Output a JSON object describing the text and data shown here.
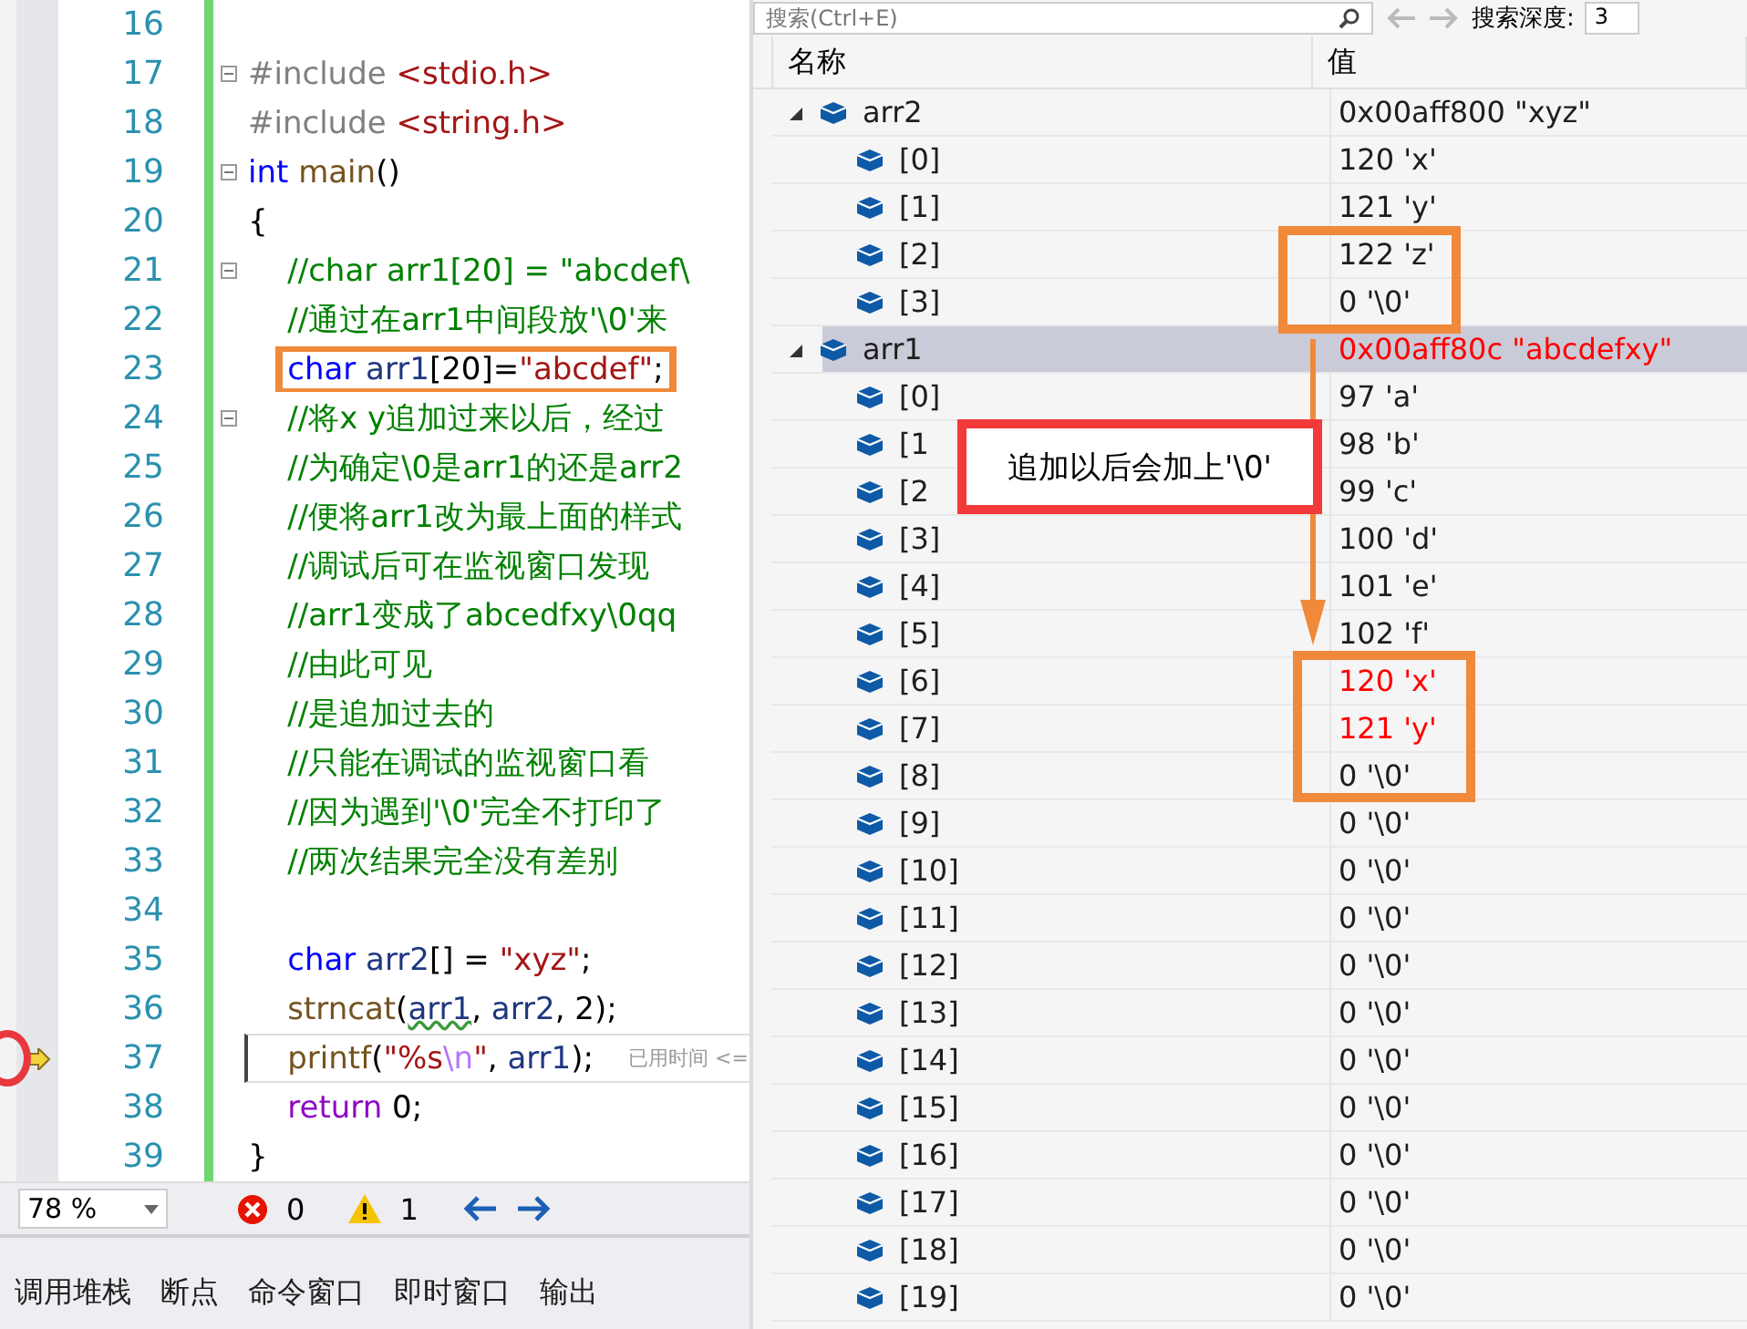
{
  "editor": {
    "lines": [
      {
        "number": "16"
      },
      {
        "number": "17",
        "fold": true,
        "tokens": [
          {
            "kind": "pre",
            "text": "#include "
          },
          {
            "kind": "path",
            "text": "<stdio.h>"
          }
        ]
      },
      {
        "number": "18",
        "tokens": [
          {
            "kind": "pre",
            "text": "#include "
          },
          {
            "kind": "path",
            "text": "<string.h>"
          }
        ]
      },
      {
        "number": "19",
        "fold": true,
        "tokens": [
          {
            "kind": "kw",
            "text": "int"
          },
          {
            "kind": "fn",
            "text": " main"
          },
          {
            "kind": "plain",
            "text": "()"
          }
        ]
      },
      {
        "number": "20",
        "tokens": [
          {
            "kind": "plain",
            "text": "{"
          }
        ]
      },
      {
        "number": "21",
        "fold": true,
        "tokens": [
          {
            "kind": "cm",
            "text": "    //char arr1[20] = \"abcdef\\"
          }
        ]
      },
      {
        "number": "22",
        "tokens": [
          {
            "kind": "cm",
            "text": "    //通过在arr1中间段放'\\0'来"
          }
        ]
      },
      {
        "number": "23",
        "highlighted": true,
        "tokens": [
          {
            "kind": "kw",
            "text": "    char"
          },
          {
            "kind": "id",
            "text": " arr1"
          },
          {
            "kind": "plain",
            "text": "[20]="
          },
          {
            "kind": "str",
            "text": "\"abcdef\""
          },
          {
            "kind": "plain",
            "text": ";"
          }
        ]
      },
      {
        "number": "24",
        "fold": true,
        "tokens": [
          {
            "kind": "cm",
            "text": "    //将x y追加过来以后，经过"
          }
        ]
      },
      {
        "number": "25",
        "tokens": [
          {
            "kind": "cm",
            "text": "    //为确定\\0是arr1的还是arr2"
          }
        ]
      },
      {
        "number": "26",
        "tokens": [
          {
            "kind": "cm",
            "text": "    //便将arr1改为最上面的样式"
          }
        ]
      },
      {
        "number": "27",
        "tokens": [
          {
            "kind": "cm",
            "text": "    //调试后可在监视窗口发现"
          }
        ]
      },
      {
        "number": "28",
        "tokens": [
          {
            "kind": "cm",
            "text": "    //arr1变成了abcedfxy\\0qq"
          }
        ]
      },
      {
        "number": "29",
        "tokens": [
          {
            "kind": "cm",
            "text": "    //由此可见"
          }
        ]
      },
      {
        "number": "30",
        "tokens": [
          {
            "kind": "cm",
            "text": "    //是追加过去的"
          }
        ]
      },
      {
        "number": "31",
        "tokens": [
          {
            "kind": "cm",
            "text": "    //只能在调试的监视窗口看"
          }
        ]
      },
      {
        "number": "32",
        "tokens": [
          {
            "kind": "cm",
            "text": "    //因为遇到'\\0'完全不打印了"
          }
        ]
      },
      {
        "number": "33",
        "tokens": [
          {
            "kind": "cm",
            "text": "    //两次结果完全没有差别"
          }
        ]
      },
      {
        "number": "34"
      },
      {
        "number": "35",
        "tokens": [
          {
            "kind": "kw",
            "text": "    char"
          },
          {
            "kind": "id",
            "text": " arr2"
          },
          {
            "kind": "plain",
            "text": "[] = "
          },
          {
            "kind": "str",
            "text": "\"xyz\""
          },
          {
            "kind": "plain",
            "text": ";"
          }
        ]
      },
      {
        "number": "36",
        "tokens": [
          {
            "kind": "fn",
            "text": "    strncat"
          },
          {
            "kind": "plain",
            "text": "("
          },
          {
            "kind": "id",
            "text": "arr1",
            "warn": true
          },
          {
            "kind": "plain",
            "text": ", "
          },
          {
            "kind": "id",
            "text": "arr2"
          },
          {
            "kind": "plain",
            "text": ", 2);"
          }
        ]
      },
      {
        "number": "37",
        "current": true,
        "hint": "已用时间 <=",
        "tokens": [
          {
            "kind": "fn",
            "text": "    printf"
          },
          {
            "kind": "plain",
            "text": "("
          },
          {
            "kind": "str",
            "text": "\"%s"
          },
          {
            "kind": "esc",
            "text": "\\n"
          },
          {
            "kind": "str",
            "text": "\""
          },
          {
            "kind": "plain",
            "text": ", "
          },
          {
            "kind": "id",
            "text": "arr1"
          },
          {
            "kind": "plain",
            "text": ");"
          }
        ]
      },
      {
        "number": "38",
        "tokens": [
          {
            "kind": "ctl",
            "text": "    return"
          },
          {
            "kind": "plain",
            "text": " 0;"
          }
        ]
      },
      {
        "number": "39",
        "tokens": [
          {
            "kind": "plain",
            "text": "}"
          }
        ]
      }
    ]
  },
  "status_bar": {
    "zoom": "78 %",
    "errors": "0",
    "warnings": "1"
  },
  "bottom_tabs": [
    "调用堆栈",
    "断点",
    "命令窗口",
    "即时窗口",
    "输出"
  ],
  "watch": {
    "search": {
      "placeholder": "搜索(Ctrl+E)"
    },
    "depth_label": "搜索深度:",
    "depth": "3",
    "columns": [
      "名称",
      "值"
    ],
    "rows": [
      {
        "name": "arr2",
        "value": "0x00aff800 \"xyz\"",
        "expanded": true,
        "selected": false,
        "changed": false,
        "children": [
          {
            "name": "[0]",
            "value": "120 'x'",
            "selected": false,
            "changed": false
          },
          {
            "name": "[1]",
            "value": "121 'y'",
            "selected": false,
            "changed": false
          },
          {
            "name": "[2]",
            "value": "122 'z'",
            "selected": false,
            "changed": false
          },
          {
            "name": "[3]",
            "value": "0 '\\0'",
            "selected": false,
            "changed": false
          }
        ]
      },
      {
        "name": "arr1",
        "value": "0x00aff80c \"abcdefxy\"",
        "expanded": true,
        "selected": true,
        "changed": true,
        "children": [
          {
            "name": "[0]",
            "value": "97 'a'",
            "selected": false,
            "changed": false
          },
          {
            "name": "[1",
            "value": "98 'b'",
            "selected": false,
            "changed": false
          },
          {
            "name": "[2",
            "value": "99 'c'",
            "selected": false,
            "changed": false
          },
          {
            "name": "[3]",
            "value": "100 'd'",
            "selected": false,
            "changed": false
          },
          {
            "name": "[4]",
            "value": "101 'e'",
            "selected": false,
            "changed": false
          },
          {
            "name": "[5]",
            "value": "102 'f'",
            "selected": false,
            "changed": false
          },
          {
            "name": "[6]",
            "value": "120 'x'",
            "selected": false,
            "changed": true
          },
          {
            "name": "[7]",
            "value": "121 'y'",
            "selected": false,
            "changed": true
          },
          {
            "name": "[8]",
            "value": "0 '\\0'",
            "selected": false,
            "changed": false
          },
          {
            "name": "[9]",
            "value": "0 '\\0'",
            "selected": false,
            "changed": false
          },
          {
            "name": "[10]",
            "value": "0 '\\0'",
            "selected": false,
            "changed": false
          },
          {
            "name": "[11]",
            "value": "0 '\\0'",
            "selected": false,
            "changed": false
          },
          {
            "name": "[12]",
            "value": "0 '\\0'",
            "selected": false,
            "changed": false
          },
          {
            "name": "[13]",
            "value": "0 '\\0'",
            "selected": false,
            "changed": false
          },
          {
            "name": "[14]",
            "value": "0 '\\0'",
            "selected": false,
            "changed": false
          },
          {
            "name": "[15]",
            "value": "0 '\\0'",
            "selected": false,
            "changed": false
          },
          {
            "name": "[16]",
            "value": "0 '\\0'",
            "selected": false,
            "changed": false
          },
          {
            "name": "[17]",
            "value": "0 '\\0'",
            "selected": false,
            "changed": false
          },
          {
            "name": "[18]",
            "value": "0 '\\0'",
            "selected": false,
            "changed": false
          },
          {
            "name": "[19]",
            "value": "0 '\\0'",
            "selected": false,
            "changed": false
          }
        ]
      }
    ]
  },
  "annotation": {
    "callout": "追加以后会加上'\\0'"
  }
}
